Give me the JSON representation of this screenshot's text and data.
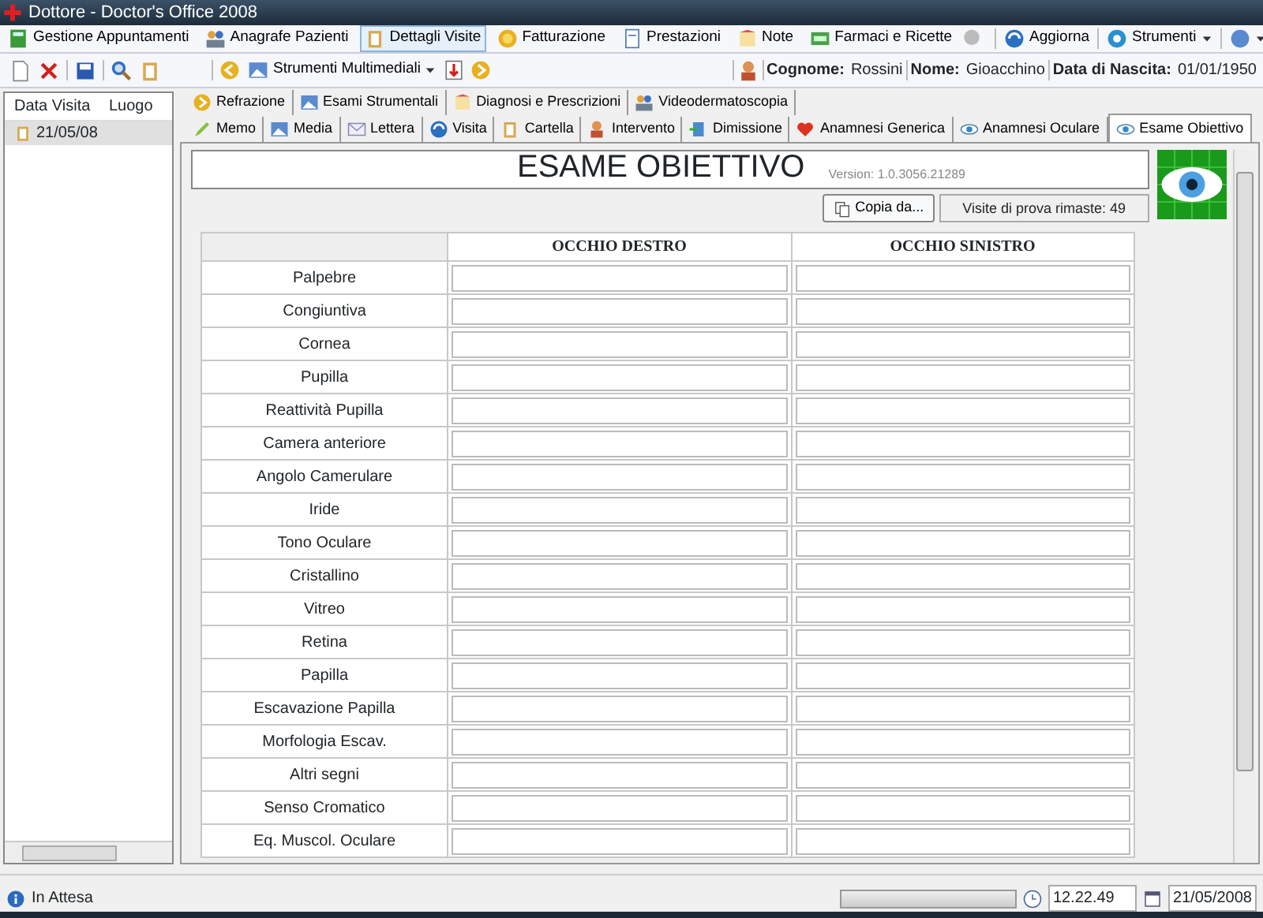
{
  "window": {
    "title": "Dottore - Doctor's Office 2008"
  },
  "menu": [
    {
      "label": "Gestione Appuntamenti",
      "selected": false
    },
    {
      "label": "Anagrafe Pazienti",
      "selected": false
    },
    {
      "label": "Dettagli Visite",
      "selected": true
    },
    {
      "label": "Fatturazione",
      "selected": false
    },
    {
      "label": "Prestazioni",
      "selected": false
    },
    {
      "label": "Note",
      "selected": false
    },
    {
      "label": "Farmaci e Ricette",
      "selected": false
    }
  ],
  "menu_right": [
    {
      "label": "Aggiorna",
      "dropdown": false
    },
    {
      "label": "Strumenti",
      "dropdown": true
    }
  ],
  "toolbar": {
    "multimedia": "Strumenti Multimediali"
  },
  "patient": [
    {
      "label": "Cognome:",
      "value": "Rossini"
    },
    {
      "label": "Nome:",
      "value": "Gioacchino"
    },
    {
      "label": "Data di Nascita:",
      "value": "01/01/1950"
    }
  ],
  "visits": {
    "columns": [
      "Data Visita",
      "Luogo"
    ],
    "rows": [
      {
        "date": "21/05/08",
        "selected": true
      }
    ]
  },
  "tabs_row1": [
    {
      "label": "Refrazione",
      "selected": false
    },
    {
      "label": "Esami Strumentali",
      "selected": false
    },
    {
      "label": "Diagnosi e Prescrizioni",
      "selected": false
    },
    {
      "label": "Videodermatoscopia",
      "selected": false
    }
  ],
  "tabs_row2": [
    {
      "label": "Memo",
      "selected": false
    },
    {
      "label": "Media",
      "selected": false
    },
    {
      "label": "Lettera",
      "selected": false
    },
    {
      "label": "Visita",
      "selected": false
    },
    {
      "label": "Cartella",
      "selected": false
    },
    {
      "label": "Intervento",
      "selected": false
    },
    {
      "label": "Dimissione",
      "selected": false
    },
    {
      "label": "Anamnesi Generica",
      "selected": false
    },
    {
      "label": "Anamnesi Oculare",
      "selected": false
    },
    {
      "label": "Esame Obiettivo",
      "selected": true
    }
  ],
  "form": {
    "title": "ESAME OBIETTIVO",
    "version": "Version: 1.0.3056.21289",
    "copy_button": "Copia da...",
    "trial": "Visite di prova rimaste: 49",
    "columns": [
      "OCCHIO DESTRO",
      "OCCHIO SINISTRO"
    ],
    "rows": [
      "Palpebre",
      "Congiuntiva",
      "Cornea",
      "Pupilla",
      "Reattività Pupilla",
      "Camera anteriore",
      "Angolo Camerulare",
      "Iride",
      "Tono Oculare",
      "Cristallino",
      "Vitreo",
      "Retina",
      "Papilla",
      "Escavazione Papilla",
      "Morfologia Escav.",
      "Altri segni",
      "Senso Cromatico",
      "Eq. Muscol. Oculare"
    ]
  },
  "status_bar": {
    "status": "In Attesa",
    "level": 0,
    "time": "12.22.49",
    "date": "21/05/2008"
  }
}
